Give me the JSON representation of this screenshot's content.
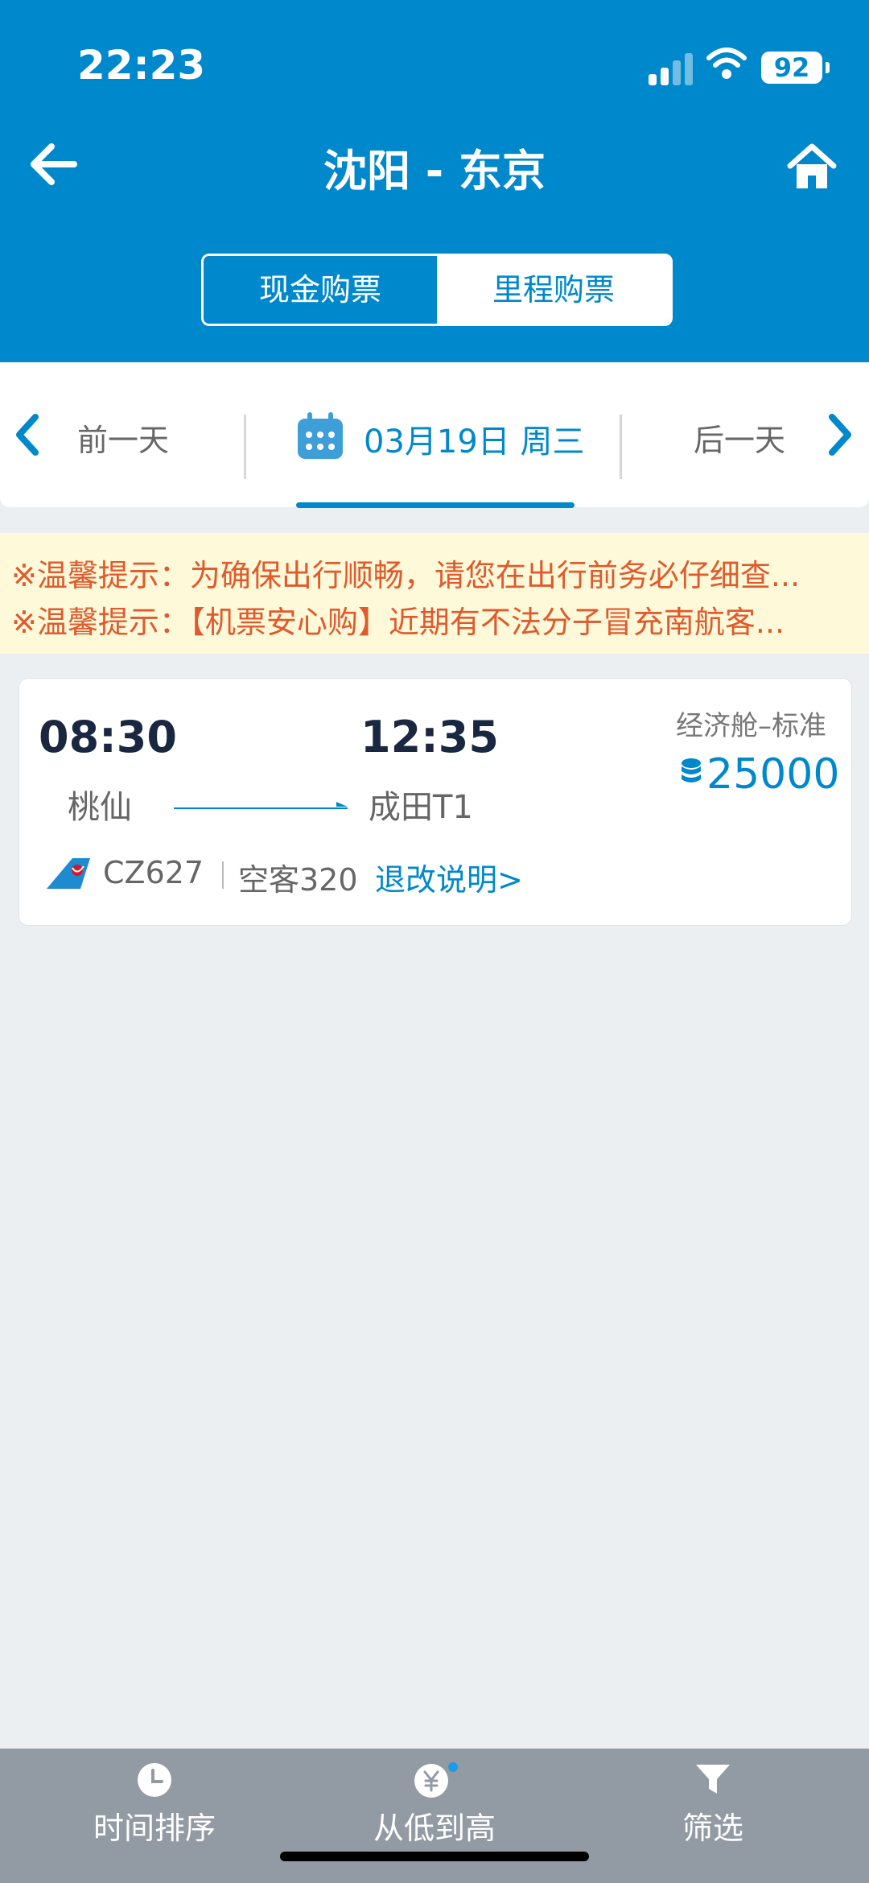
{
  "status": {
    "time": "22:23",
    "battery": "92"
  },
  "header": {
    "title": "沈阳 - 东京"
  },
  "segment": {
    "cash_label": "现金购票",
    "miles_label": "里程购票"
  },
  "datebar": {
    "prev_label": "前一天",
    "date_label": "03月19日  周三",
    "next_label": "后一天"
  },
  "notices": [
    "※温馨提示：为确保出行顺畅，请您在出行前务必仔细查...",
    "※温馨提示：【机票安心购】近期有不法分子冒充南航客..."
  ],
  "flight": {
    "dep_time": "08:30",
    "arr_time": "12:35",
    "dep_airport": "桃仙",
    "arr_airport": "成田T1",
    "cabin": "经济舱–标准",
    "price": "25000",
    "flight_no": "CZ627",
    "aircraft": "空客320",
    "refund_label": "退改说明>"
  },
  "bottom_tabs": [
    {
      "label": "时间排序",
      "icon": "clock-icon"
    },
    {
      "label": "从低到高",
      "icon": "yuan-icon"
    },
    {
      "label": "筛选",
      "icon": "filter-icon"
    }
  ],
  "colors": {
    "brand": "#0088cc",
    "notice_text": "#e05a2d",
    "notice_bg": "#fdf9d9"
  }
}
